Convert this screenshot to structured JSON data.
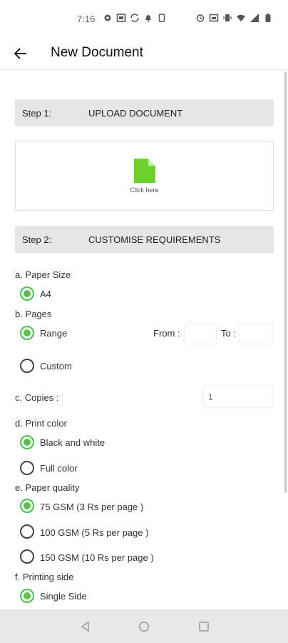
{
  "status_bar": {
    "time": "7:16",
    "icons": [
      "settings-icon",
      "image-icon",
      "sync-icon",
      "notification-icon",
      "sim-icon",
      "alarm-icon",
      "cast-icon",
      "vibrate-icon",
      "wifi-icon",
      "signal-icon",
      "battery-icon"
    ]
  },
  "app_bar": {
    "title": "New Document",
    "back_icon": "arrow-back-icon"
  },
  "step1": {
    "label": "Step 1:",
    "title": "UPLOAD DOCUMENT"
  },
  "upload": {
    "hint": "Click here",
    "icon": "document-icon",
    "icon_color": "#6fd12e"
  },
  "step2": {
    "label": "Step 2:",
    "title": "CUSTOMISE REQUIREMENTS"
  },
  "paper_size": {
    "label": "a. Paper Size",
    "options": [
      {
        "label": "A4",
        "checked": true
      }
    ]
  },
  "pages": {
    "label": "b. Pages",
    "options": [
      {
        "label": "Range",
        "checked": true
      },
      {
        "label": "Custom",
        "checked": false
      }
    ],
    "from_label": "From :",
    "to_label": "To :",
    "from_value": "",
    "to_value": ""
  },
  "copies": {
    "label": "c. Copies :",
    "placeholder": "1"
  },
  "print_color": {
    "label": "d. Print color",
    "options": [
      {
        "label": "Black and white",
        "checked": true
      },
      {
        "label": "Full color",
        "checked": false
      }
    ]
  },
  "paper_quality": {
    "label": "e. Paper quality",
    "options": [
      {
        "label": "75 GSM (3 Rs per page )",
        "checked": true
      },
      {
        "label": "100 GSM (5 Rs per page )",
        "checked": false
      },
      {
        "label": "150 GSM (10 Rs per page )",
        "checked": false
      }
    ]
  },
  "printing_side": {
    "label": "f. Printing side",
    "options": [
      {
        "label": "Single Side",
        "checked": true
      }
    ]
  },
  "nav_bar": {
    "icons": [
      "nav-back-icon",
      "nav-home-icon",
      "nav-recents-icon"
    ]
  },
  "colors": {
    "accent": "#5ac24a",
    "step_bar": "#e6e6e6"
  }
}
